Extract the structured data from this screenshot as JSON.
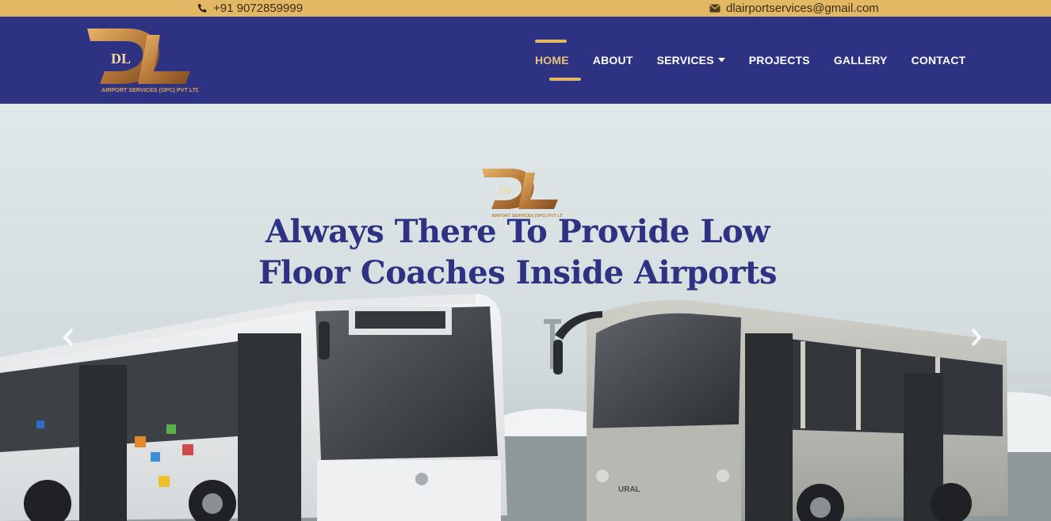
{
  "topbar": {
    "phone": "+91 9072859999",
    "email": "dlairportservices@gmail.com",
    "phone_icon": "phone-icon",
    "email_icon": "envelope-icon"
  },
  "logo": {
    "letters": "DL",
    "sub": "DL",
    "tagline": "AIRPORT SERVICES (OPC) PVT LTD"
  },
  "nav": {
    "items": [
      {
        "label": "HOME",
        "active": true
      },
      {
        "label": "ABOUT"
      },
      {
        "label": "SERVICES",
        "dropdown": true
      },
      {
        "label": "PROJECTS"
      },
      {
        "label": "GALLERY"
      },
      {
        "label": "CONTACT"
      }
    ]
  },
  "hero": {
    "title_line1": "Always There To Provide Low",
    "title_line2": "Floor Coaches Inside Airports",
    "bus_brand": "URAL",
    "prev_icon": "chevron-left-icon",
    "next_icon": "chevron-right-icon"
  },
  "colors": {
    "topbar": "#e3b865",
    "navbar": "#2e3283",
    "accent": "#e3b865",
    "title": "#2e3283"
  }
}
